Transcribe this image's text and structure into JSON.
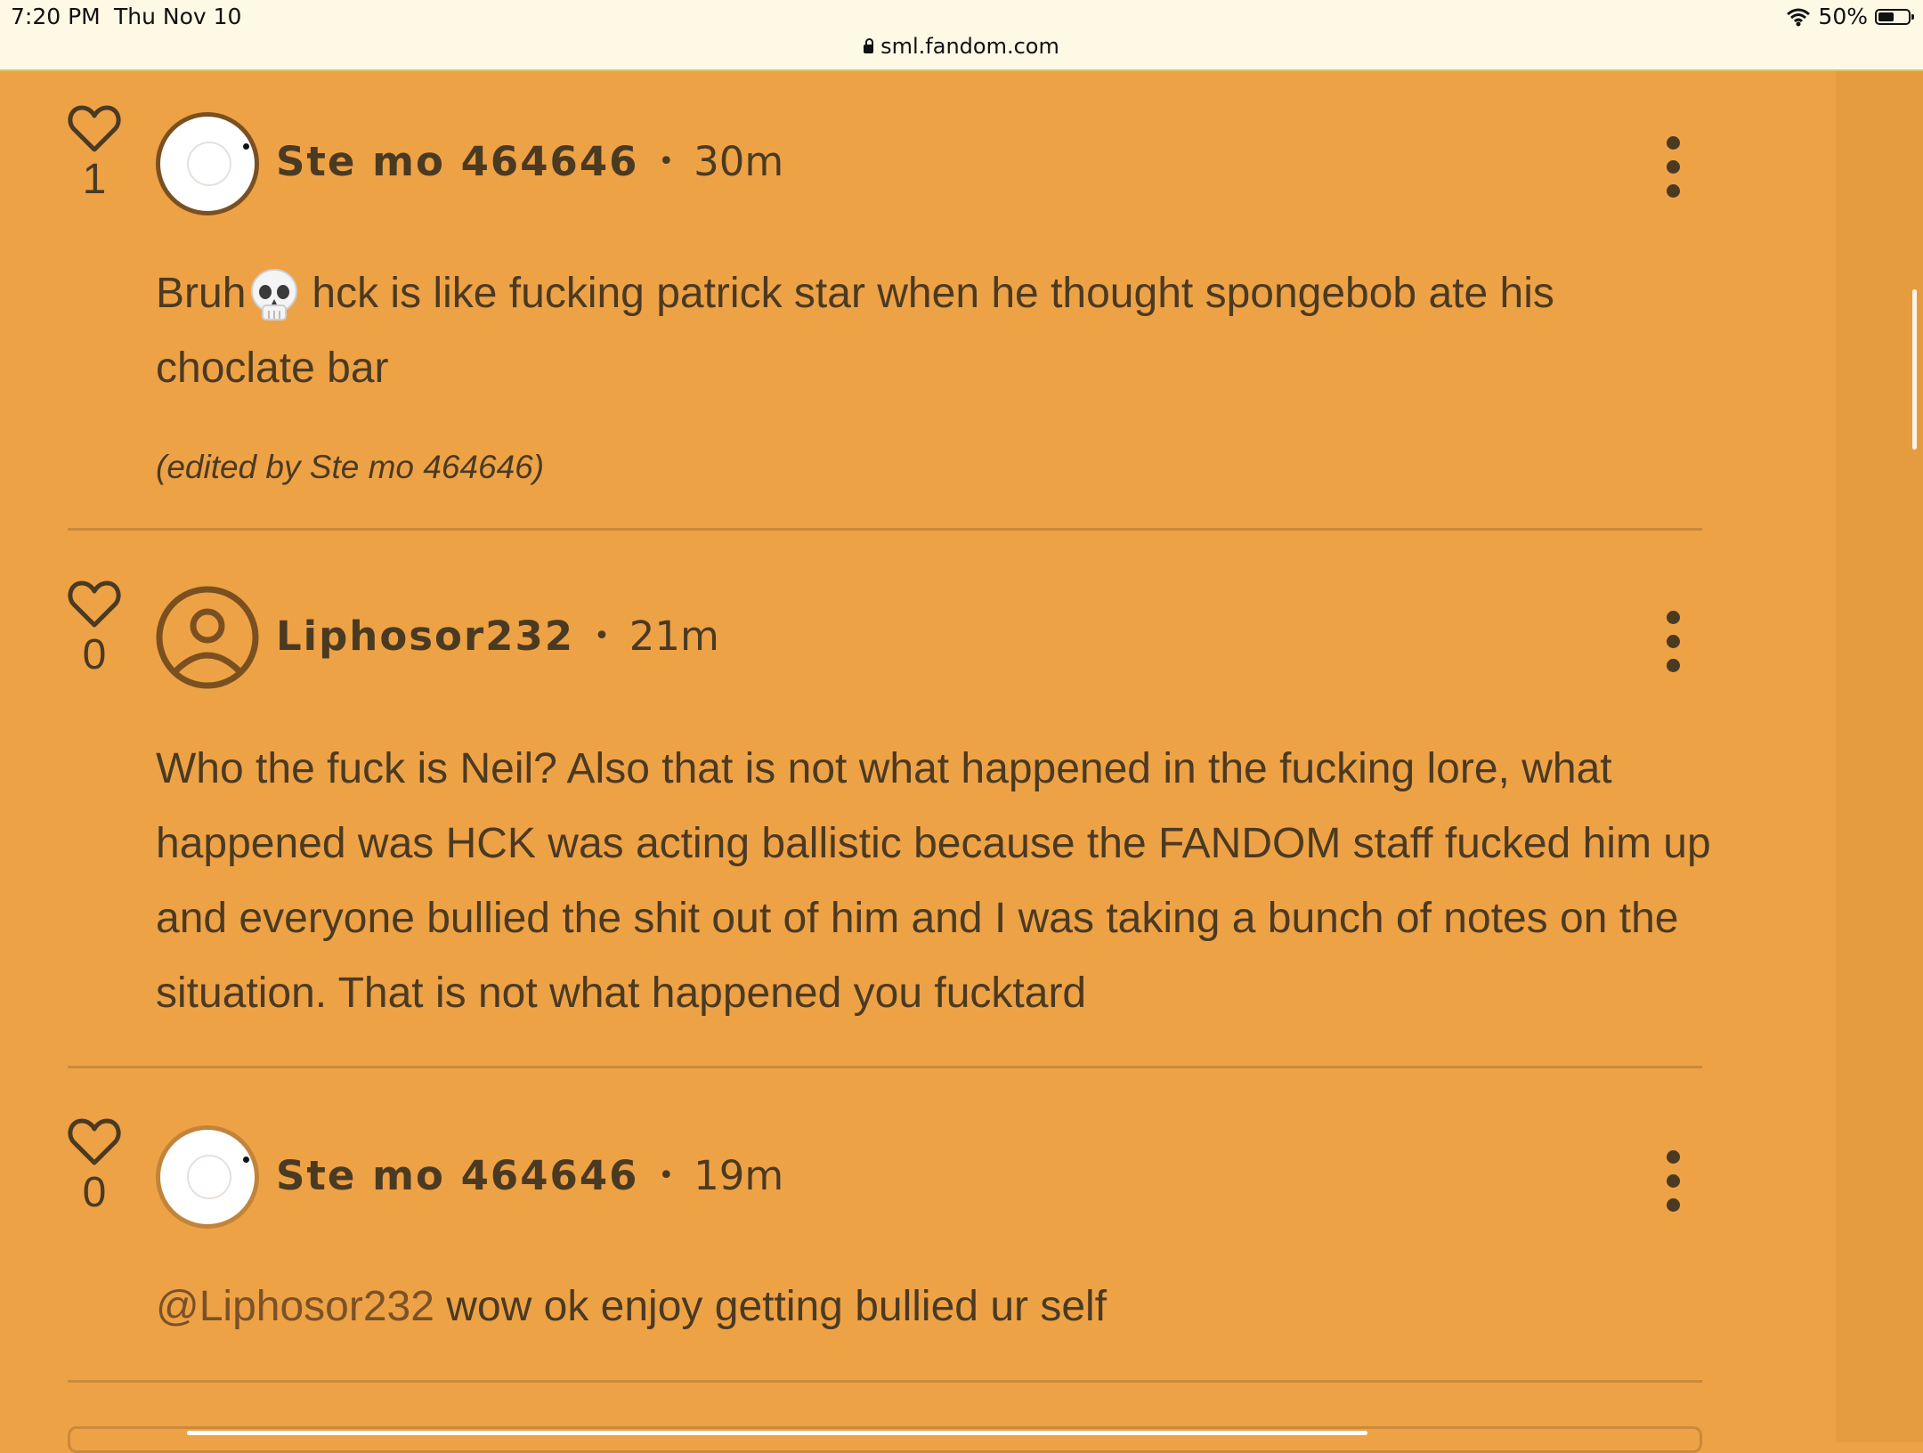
{
  "status_bar": {
    "time": "7:20 PM",
    "date": "Thu Nov 10",
    "battery": "50%",
    "battery_level": 0.5
  },
  "url_bar": {
    "url": "sml.fandom.com"
  },
  "comments": [
    {
      "likes": "1",
      "author": "Ste mo 464646",
      "separator": "•",
      "time": "30m",
      "body_before": "Bruh",
      "body_emoji": "skull-icon",
      "body_after": "hck is like fucking patrick star when he thought spongebob ate his choclate bar",
      "edited": "(edited by Ste mo 464646)"
    },
    {
      "likes": "0",
      "author": "Liphosor232",
      "separator": "•",
      "time": "21m",
      "body": "Who the fuck is Neil? Also that is not what happened in the fucking lore, what happened was HCK was acting ballistic because the FANDOM staff fucked him up and everyone bullied the shit out of him and I was taking a bunch of notes on the situation. That is not what happened you fucktard"
    },
    {
      "likes": "0",
      "author": "Ste mo 464646",
      "separator": "•",
      "time": "19m",
      "mention": "@Liphosor232",
      "body": " wow ok enjoy getting bullied ur self"
    }
  ],
  "colors": {
    "page_bg": "#EEA246",
    "text": "#4b3a22",
    "divider": "#c98a3a",
    "top_bar": "#FEF9E4"
  }
}
